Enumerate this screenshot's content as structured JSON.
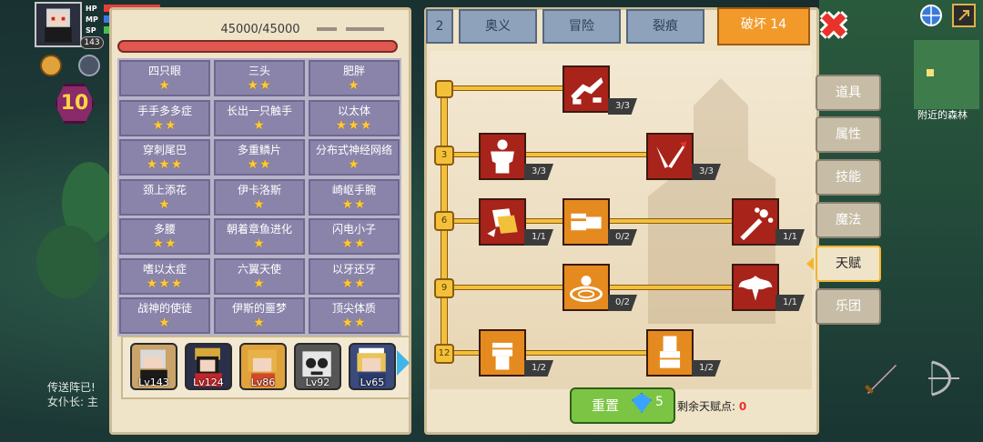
{
  "hud": {
    "bar_labels": [
      "HP",
      "MP",
      "SP"
    ],
    "level": "143",
    "area_level": "10"
  },
  "left_panel": {
    "hp": "45000/45000",
    "traits": [
      {
        "name": "四只眼",
        "stars": 1
      },
      {
        "name": "三头",
        "stars": 2
      },
      {
        "name": "肥胖",
        "stars": 1
      },
      {
        "name": "手手多多症",
        "stars": 2
      },
      {
        "name": "长出一只触手",
        "stars": 1
      },
      {
        "name": "以太体",
        "stars": 3
      },
      {
        "name": "穿刺尾巴",
        "stars": 3
      },
      {
        "name": "多重鳞片",
        "stars": 2
      },
      {
        "name": "分布式神经网络",
        "stars": 1
      },
      {
        "name": "颈上添花",
        "stars": 1
      },
      {
        "name": "伊卡洛斯",
        "stars": 1
      },
      {
        "name": "崎岖手腕",
        "stars": 2
      },
      {
        "name": "多腰",
        "stars": 2
      },
      {
        "name": "朝着章鱼进化",
        "stars": 1
      },
      {
        "name": "闪电小子",
        "stars": 2
      },
      {
        "name": "嗜以太症",
        "stars": 3
      },
      {
        "name": "六翼天使",
        "stars": 1
      },
      {
        "name": "以牙还牙",
        "stars": 2
      },
      {
        "name": "战神的使徒",
        "stars": 1
      },
      {
        "name": "伊斯的噩梦",
        "stars": 1
      },
      {
        "name": "顶尖体质",
        "stars": 2
      }
    ],
    "team": [
      {
        "level": "Lv143"
      },
      {
        "level": "Lv124"
      },
      {
        "level": "Lv86"
      },
      {
        "level": "Lv92"
      },
      {
        "level": "Lv65"
      }
    ]
  },
  "tabs": [
    {
      "label": "2"
    },
    {
      "label": "奥义"
    },
    {
      "label": "冒险"
    },
    {
      "label": "裂痕"
    },
    {
      "label": "破坏 14",
      "active": true
    }
  ],
  "talent_tree": {
    "tiers": [
      "",
      "3",
      "6",
      "9",
      "12"
    ],
    "skills": [
      {
        "id": "arm-wrestle",
        "count": "3/3",
        "color": "red"
      },
      {
        "id": "body",
        "count": "3/3",
        "color": "red"
      },
      {
        "id": "arrow-hit",
        "count": "3/3",
        "color": "red"
      },
      {
        "id": "shatter",
        "count": "1/1",
        "color": "red"
      },
      {
        "id": "fist-palm",
        "count": "0/2",
        "color": "orange"
      },
      {
        "id": "splash",
        "count": "1/1",
        "color": "red"
      },
      {
        "id": "ripple",
        "count": "0/2",
        "color": "orange"
      },
      {
        "id": "flame-wings",
        "count": "1/1",
        "color": "red"
      },
      {
        "id": "fist-up",
        "count": "1/2",
        "color": "orange"
      },
      {
        "id": "fist-down",
        "count": "1/2",
        "color": "orange"
      }
    ],
    "reset_label": "重置",
    "reset_cost": "5",
    "remaining_label": "剩余天赋点:",
    "remaining_value": "0"
  },
  "side_tabs": [
    {
      "label": "道具"
    },
    {
      "label": "属性"
    },
    {
      "label": "技能"
    },
    {
      "label": "魔法"
    },
    {
      "label": "天赋",
      "active": true
    },
    {
      "label": "乐团"
    }
  ],
  "map": {
    "label": "附近的森林"
  },
  "bottom_msg": {
    "line1": "传送阵已!",
    "line2": "女仆长: 主"
  },
  "colors": {
    "accent": "#f19a2a",
    "skill_red": "#a8231a",
    "skill_orange": "#e58a1f",
    "star": "#ffc93a"
  }
}
